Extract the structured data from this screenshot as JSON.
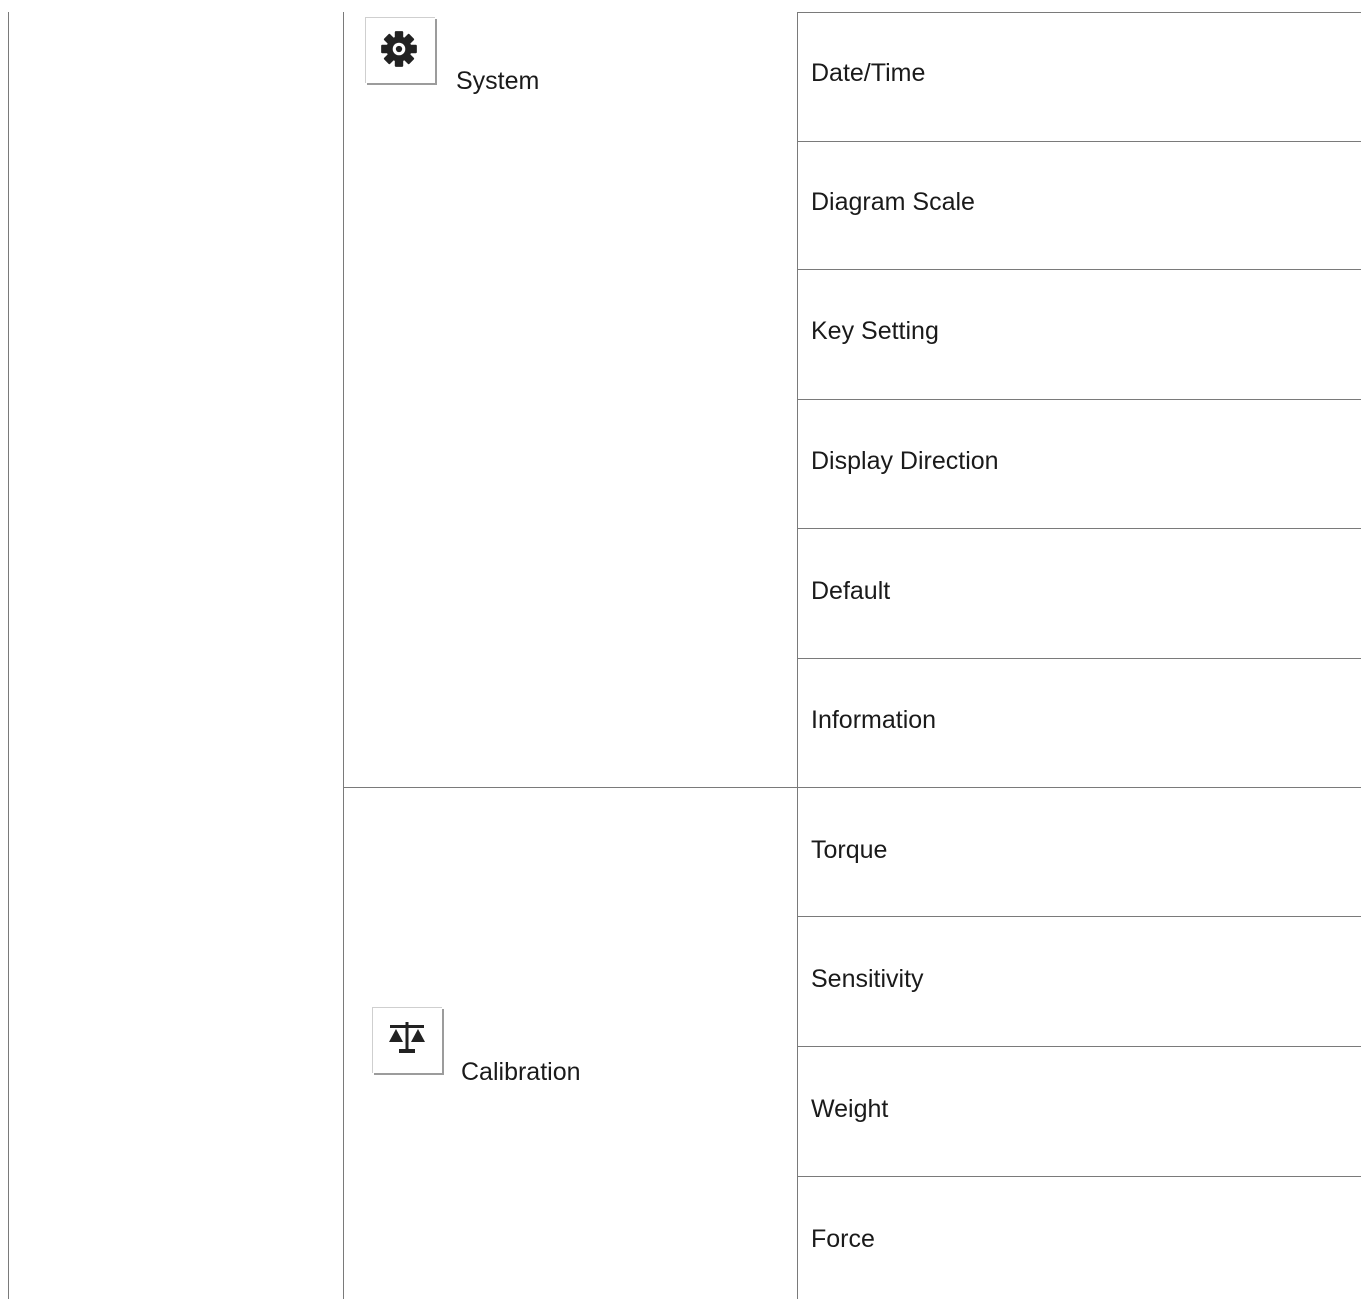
{
  "categories": [
    {
      "label": "System",
      "icon": "gear-icon",
      "items": [
        "Date/Time",
        "Diagram Scale",
        "Key Setting",
        "Display Direction",
        "Default",
        "Information"
      ]
    },
    {
      "label": "Calibration",
      "icon": "balance-scale-icon",
      "items": [
        "Torque",
        "Sensitivity",
        "Weight",
        "Force"
      ]
    }
  ]
}
